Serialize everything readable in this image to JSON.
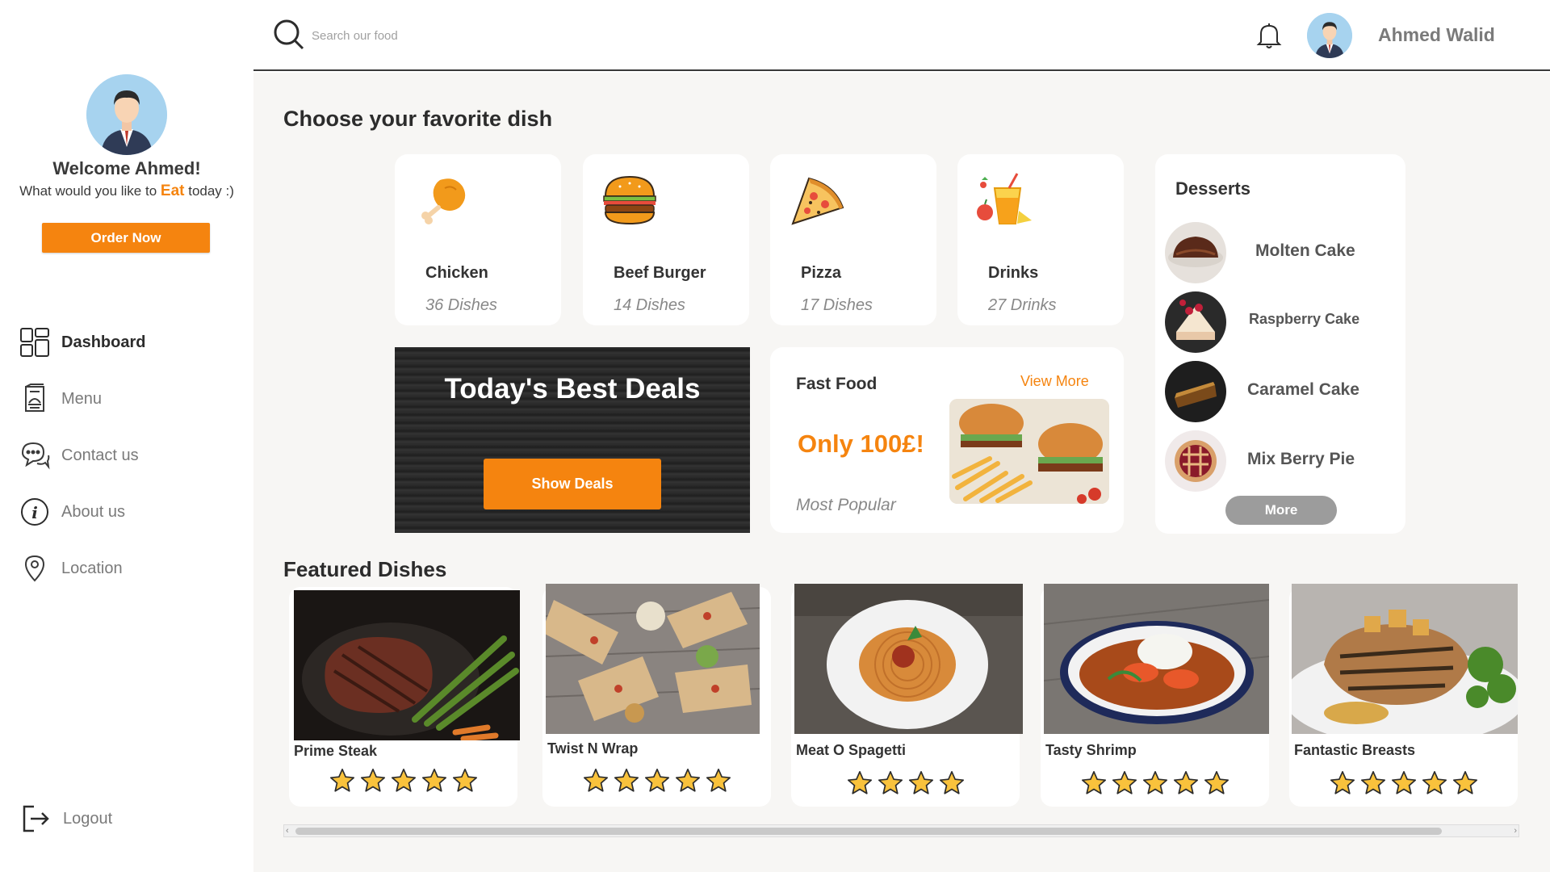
{
  "sidebar": {
    "welcome": "Welcome Ahmed!",
    "subtitle_pre": "What would you like to",
    "subtitle_eat": "Eat",
    "subtitle_post": "today :)",
    "order_button": "Order Now",
    "nav": [
      {
        "label": "Dashboard",
        "icon": "dashboard-icon"
      },
      {
        "label": "Menu",
        "icon": "menu-icon"
      },
      {
        "label": "Contact us",
        "icon": "chat-icon"
      },
      {
        "label": "About us",
        "icon": "info-icon"
      },
      {
        "label": "Location",
        "icon": "location-pin-icon"
      }
    ],
    "logout": "Logout"
  },
  "topbar": {
    "search_placeholder": "Search our food",
    "username": "Ahmed Walid"
  },
  "main": {
    "heading": "Choose your favorite dish",
    "categories": [
      {
        "name": "Chicken",
        "count": "36 Dishes",
        "icon": "chicken-icon"
      },
      {
        "name": "Beef Burger",
        "count": "14 Dishes",
        "icon": "burger-icon"
      },
      {
        "name": "Pizza",
        "count": "17 Dishes",
        "icon": "pizza-icon"
      },
      {
        "name": "Drinks",
        "count": "27 Drinks",
        "icon": "drink-icon"
      }
    ],
    "deals": {
      "title": "Today's Best Deals",
      "button": "Show Deals"
    },
    "fast_food": {
      "title": "Fast Food",
      "view_more": "View More",
      "price": "Only 100£!",
      "tag": "Most Popular"
    },
    "desserts": {
      "title": "Desserts",
      "items": [
        "Molten Cake",
        "Raspberry Cake",
        "Caramel Cake",
        "Mix Berry Pie"
      ],
      "more_button": "More"
    },
    "featured_heading": "Featured Dishes",
    "featured": [
      {
        "name": "Prime Steak",
        "rating": 5
      },
      {
        "name": "Twist N Wrap",
        "rating": 5
      },
      {
        "name": "Meat O Spagetti",
        "rating": 4
      },
      {
        "name": "Tasty Shrimp",
        "rating": 5
      },
      {
        "name": "Fantastic Breasts",
        "rating": 5
      }
    ]
  },
  "colors": {
    "accent": "#f5840f",
    "main_bg": "#f7f6f4",
    "star": "#f9c23c"
  }
}
